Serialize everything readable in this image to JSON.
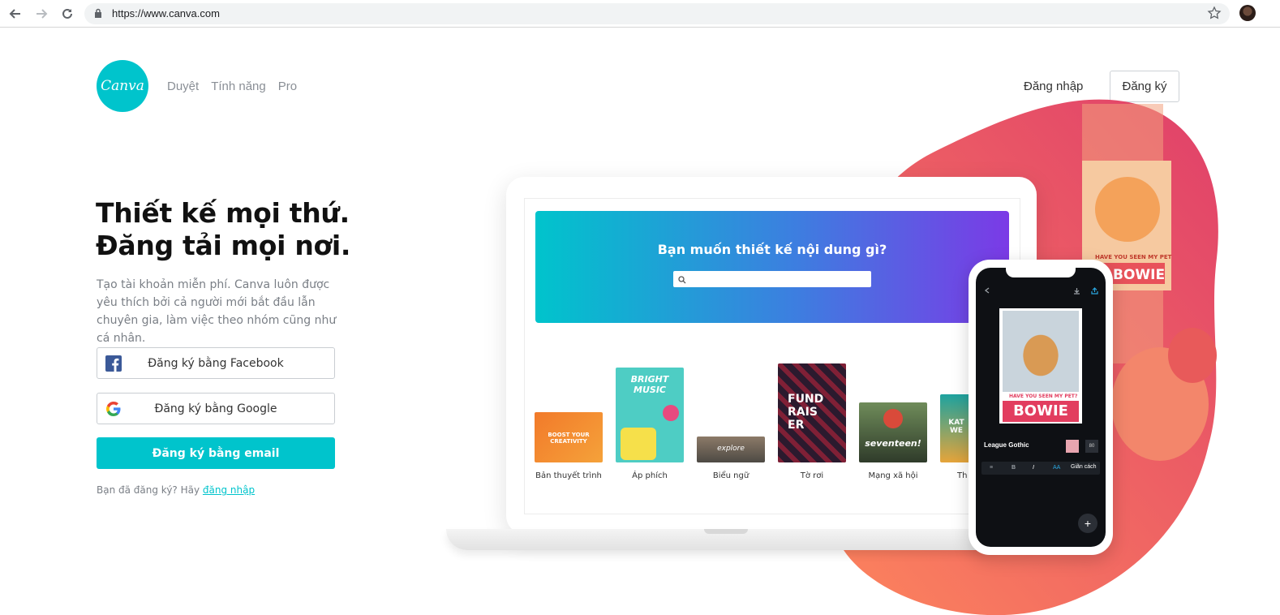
{
  "browser": {
    "url": "https://www.canva.com"
  },
  "header": {
    "logo_text": "Canva",
    "nav": [
      "Duyệt",
      "Tính năng",
      "Pro"
    ],
    "login": "Đăng nhập",
    "signup": "Đăng ký"
  },
  "hero": {
    "headline_line1": "Thiết kế mọi thứ.",
    "headline_line2": "Đăng tải mọi nơi.",
    "subtext": "Tạo tài khoản miễn phí. Canva luôn được yêu thích bởi cả người mới bắt đầu lẫn chuyên gia, làm việc theo nhóm cũng như cá nhân.",
    "facebook_button": "Đăng ký bằng Facebook",
    "google_button": "Đăng ký bằng Google",
    "email_button": "Đăng ký bằng email",
    "already_text": "Bạn đã đăng ký? Hãy",
    "already_link": "đăng nhập"
  },
  "illustration": {
    "banner_title": "Bạn muốn thiết kế nội dung gì?",
    "tiles": [
      {
        "label": "Bản thuyết trình",
        "text": "BOOST YOUR CREATIVITY"
      },
      {
        "label": "Áp phích",
        "text": "BRIGHT MUSIC"
      },
      {
        "label": "Biểu ngữ",
        "text": "explore"
      },
      {
        "label": "Tờ rơi",
        "text": "FUND RAIS ER"
      },
      {
        "label": "Mạng xã hội",
        "text": "seventeen!"
      },
      {
        "label": "Th",
        "text": "KAT WE"
      }
    ],
    "phone": {
      "card_caption": "HAVE YOU SEEN MY PET?",
      "card_title": "BOWIE",
      "font_name": "League Gothic",
      "font_size": "80",
      "spacing_label": "Giãn cách"
    },
    "poster_caption": "HAVE YOU SEEN MY PET",
    "poster_title": "BOWIE"
  },
  "colors": {
    "brand": "#00c4cc",
    "blob_start": "#ff7b5c",
    "blob_end": "#e0406a"
  }
}
